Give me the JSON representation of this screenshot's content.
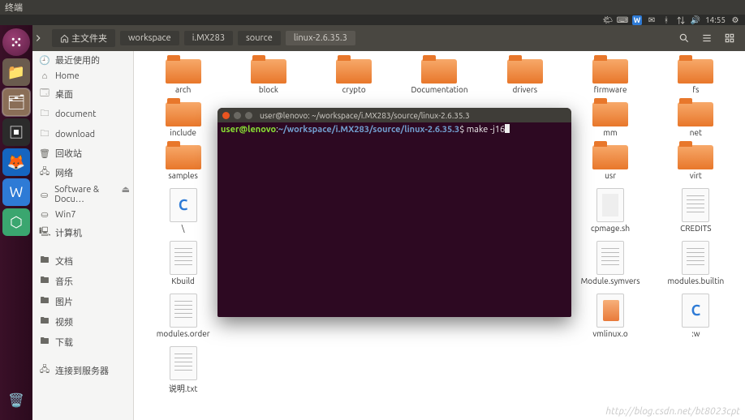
{
  "titlebar": {
    "app": "终端"
  },
  "panel": {
    "time": "14:55",
    "wps_letter": "W"
  },
  "toolbar": {
    "home_label": "主文件夹",
    "crumbs": [
      "workspace",
      "i.MX283",
      "source",
      "linux-2.6.35.3"
    ]
  },
  "sidebar": {
    "recent": "最近使用的",
    "home": "Home",
    "desktop": "桌面",
    "document": "document",
    "download": "download",
    "trash": "回收站",
    "network": "网络",
    "soft": "Software & Docu…",
    "win7": "Win7",
    "computer": "计算机",
    "docs": "文档",
    "music": "音乐",
    "pics": "图片",
    "video": "视频",
    "downloads2": "下载",
    "connect": "连接到服务器"
  },
  "grid": {
    "items": [
      {
        "t": "folder",
        "l": "arch"
      },
      {
        "t": "folder",
        "l": "block"
      },
      {
        "t": "folder",
        "l": "crypto"
      },
      {
        "t": "folder",
        "l": "Documentation"
      },
      {
        "t": "folder",
        "l": "drivers"
      },
      {
        "t": "folder",
        "l": "firmware"
      },
      {
        "t": "folder",
        "l": "fs"
      },
      {
        "t": "folder",
        "l": "include"
      },
      {
        "t": "hidden",
        "l": ""
      },
      {
        "t": "hidden",
        "l": ""
      },
      {
        "t": "hidden",
        "l": ""
      },
      {
        "t": "hidden",
        "l": ""
      },
      {
        "t": "folder",
        "l": "mm"
      },
      {
        "t": "folder",
        "l": "net"
      },
      {
        "t": "folder",
        "l": "samples"
      },
      {
        "t": "hidden",
        "l": ""
      },
      {
        "t": "hidden",
        "l": ""
      },
      {
        "t": "hidden",
        "l": ""
      },
      {
        "t": "hidden",
        "l": ""
      },
      {
        "t": "folder",
        "l": "usr"
      },
      {
        "t": "folder",
        "l": "virt"
      },
      {
        "t": "cfile",
        "l": "\\"
      },
      {
        "t": "hidden",
        "l": ""
      },
      {
        "t": "hidden",
        "l": ""
      },
      {
        "t": "hidden",
        "l": ""
      },
      {
        "t": "hidden",
        "l": ""
      },
      {
        "t": "script",
        "l": "cpmage.sh"
      },
      {
        "t": "lines",
        "l": "CREDITS"
      },
      {
        "t": "lines",
        "l": "Kbuild"
      },
      {
        "t": "hidden",
        "l": ""
      },
      {
        "t": "hidden",
        "l": ""
      },
      {
        "t": "hidden",
        "l": ""
      },
      {
        "t": "hidden",
        "l": ""
      },
      {
        "t": "lines",
        "l": "Module.symvers"
      },
      {
        "t": "lines",
        "l": "modules.builtin"
      },
      {
        "t": "lines",
        "l": "modules.order"
      },
      {
        "t": "hidden",
        "l": ""
      },
      {
        "t": "hidden",
        "l": ""
      },
      {
        "t": "hidden",
        "l": ""
      },
      {
        "t": "hidden",
        "l": ""
      },
      {
        "t": "ofile",
        "l": "vmlinux.o"
      },
      {
        "t": "cfile",
        "l": ":w"
      },
      {
        "t": "lines",
        "l": "说明.txt"
      }
    ]
  },
  "terminal": {
    "title": "user@lenovo: ~/workspace/i.MX283/source/linux-2.6.35.3",
    "user": "user@lenovo",
    "colon": ":",
    "path": "~/workspace/i.MX283/source/linux-2.6.35.3",
    "prompt": "$ ",
    "cmd": "make -j16"
  },
  "watermark": "http://blog.csdn.net/bt8023cpt"
}
